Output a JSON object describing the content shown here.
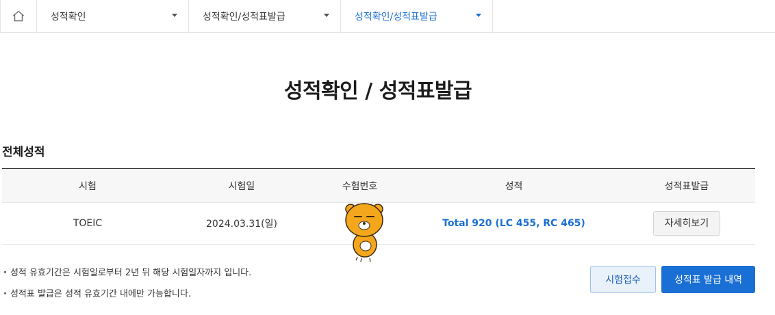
{
  "nav": {
    "crumbs": [
      {
        "label": "성적확인"
      },
      {
        "label": "성적확인/성적표발급"
      },
      {
        "label": "성적확인/성적표발급"
      }
    ]
  },
  "page": {
    "title": "성적확인 / 성적표발급"
  },
  "section": {
    "title": "전체성적"
  },
  "table": {
    "headers": [
      "시험",
      "시험일",
      "수험번호",
      "성적",
      "성적표발급"
    ],
    "rows": [
      {
        "test": "TOEIC",
        "date": "2024.03.31(일)",
        "number": "",
        "score": "Total 920 (LC 455, RC 465)",
        "action": "자세히보기"
      }
    ]
  },
  "notes": [
    "성적 유효기간은 시험일로부터 2년 뒤 해당 시험일자까지 입니다.",
    "성적표 발급은 성적 유효기간 내에만 가능합니다."
  ],
  "buttons": {
    "apply": "시험접수",
    "history": "성적표 발급 내역"
  },
  "icons": {
    "home": "home-icon",
    "dropdown": "caret-down-icon"
  },
  "colors": {
    "accent": "#1a6fd4",
    "apply_bg": "#e9f1fb"
  }
}
